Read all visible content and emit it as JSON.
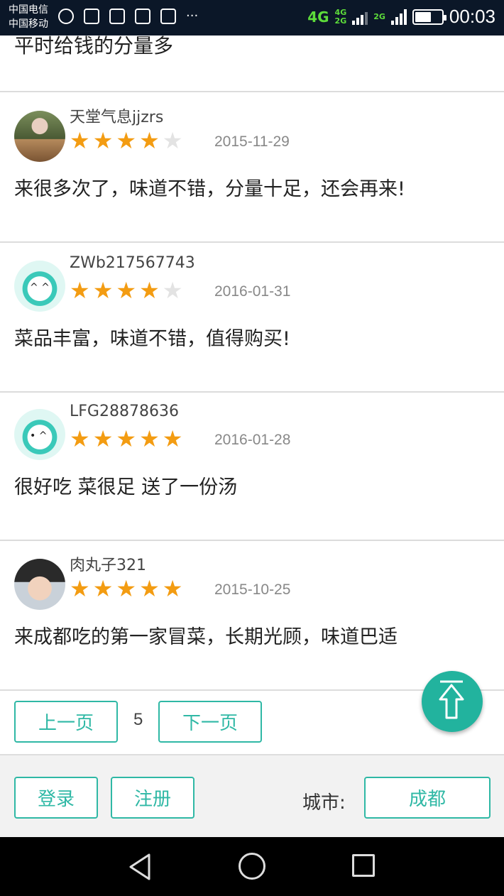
{
  "status_bar": {
    "carrier_1": "中国电信",
    "carrier_2": "中国移动",
    "net_main": "4G",
    "net_sub_1": "4G",
    "net_sub_2": "2G",
    "net_sub_3": "2G",
    "clock": "00:03",
    "more": "···"
  },
  "partial_review": {
    "comment": "平时给钱的分量多"
  },
  "reviews": [
    {
      "username": "天堂气息jjzrs",
      "rating": 4,
      "date": "2015-11-29",
      "comment": "来很多次了，味道不错，分量十足，还会再来!"
    },
    {
      "username": "ZWb217567743",
      "rating": 4,
      "date": "2016-01-31",
      "comment": "菜品丰富，味道不错，值得购买!"
    },
    {
      "username": "LFG28878636",
      "rating": 5,
      "date": "2016-01-28",
      "comment": "很好吃 菜很足 送了一份汤"
    },
    {
      "username": "肉丸子321",
      "rating": 5,
      "date": "2015-10-25",
      "comment": "来成都吃的第一家冒菜，长期光顾，味道巴适"
    }
  ],
  "pager": {
    "prev_label": "上一页",
    "page": "5",
    "next_label": "下一页"
  },
  "footer": {
    "login_label": "登录",
    "register_label": "注册",
    "city_label": "城市:",
    "city_value": "成都"
  },
  "colors": {
    "accent": "#2fb8a5",
    "star": "#f39c12",
    "star_off": "#e3e3e3"
  }
}
